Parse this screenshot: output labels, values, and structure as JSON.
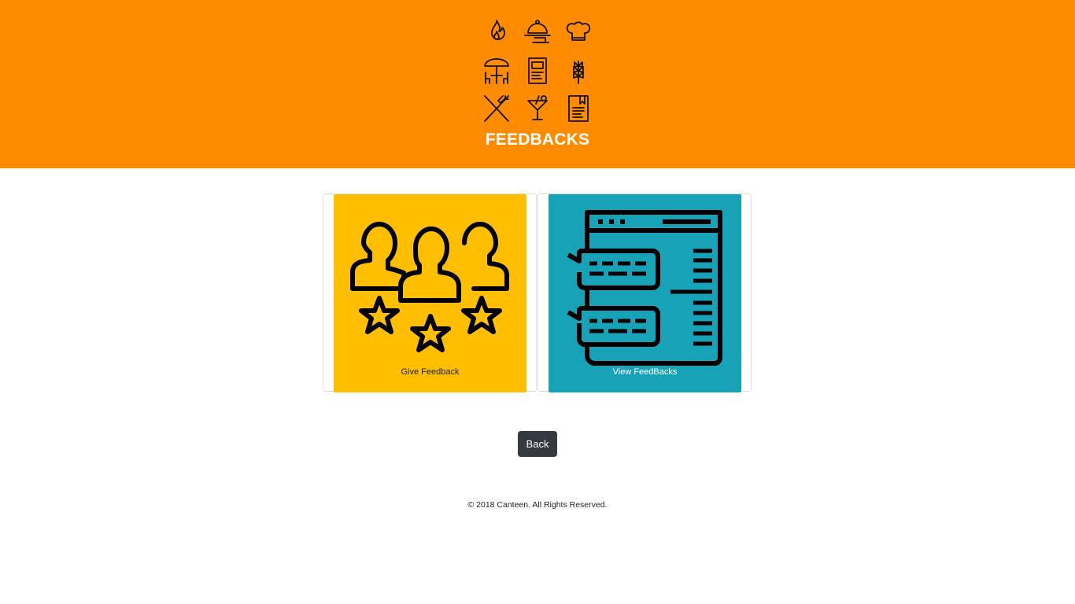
{
  "header": {
    "title": "FEEDBACKS",
    "background_color": "#ff8c00",
    "logo_icons": [
      "flame-icon",
      "cloche-icon",
      "chef-hat-icon",
      "umbrella-table-icon",
      "menu-icon",
      "wheat-icon",
      "fork-knife-icon",
      "cocktail-icon",
      "recipe-book-icon"
    ]
  },
  "cards": {
    "give": {
      "label": "Give Feedback",
      "color": "#ffbf00",
      "icon": "people-rating-icon"
    },
    "view": {
      "label": "View FeedBacks",
      "color": "#17a2b8",
      "icon": "chat-document-icon"
    }
  },
  "actions": {
    "back_label": "Back"
  },
  "footer": {
    "copyright": "© 2018 Canteen. All Rights Reserved."
  }
}
